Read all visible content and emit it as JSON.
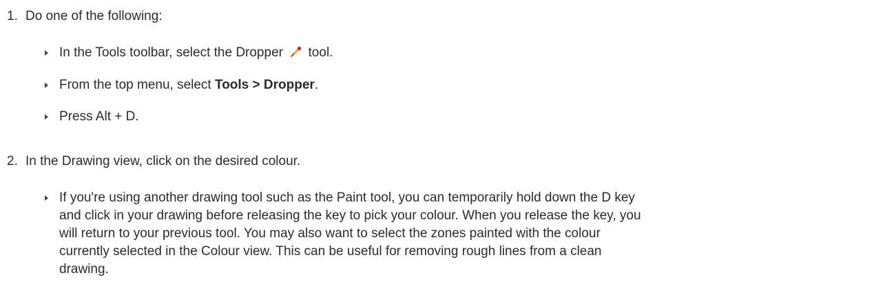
{
  "steps": [
    {
      "number": "1.",
      "text": "Do one of the following:",
      "bullets": [
        {
          "before": "In the Tools toolbar, select the Dropper",
          "icon": "dropper-icon",
          "after": "tool."
        },
        {
          "before": "From the top menu, select",
          "bold": "Tools > Dropper",
          "after": "."
        },
        {
          "text": "Press Alt + D."
        }
      ]
    },
    {
      "number": "2.",
      "text": "In the Drawing view, click on the desired colour.",
      "bullets": [
        {
          "lines": [
            "If you're using another drawing tool such as the Paint tool, you can temporarily hold down the D key",
            "and click in your drawing before releasing the key to pick your colour. When you release the key, you",
            "will return to your previous tool. You may also want to select the zones painted with the colour",
            "currently selected in the Colour view. This can be useful for removing rough lines from a clean",
            "drawing."
          ]
        }
      ]
    }
  ],
  "colors": {
    "text": "#2b2b2b",
    "dropper_tip": "#cc2222",
    "dropper_body": "#e8a23a"
  }
}
